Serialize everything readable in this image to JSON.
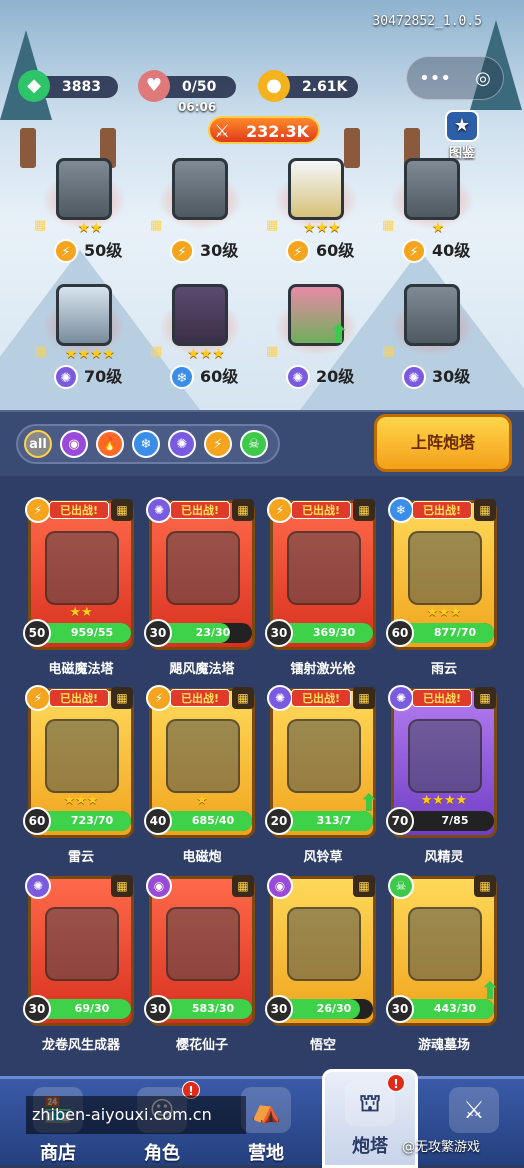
{
  "version": "30472852_1.0.5",
  "resources": {
    "gems": "3883",
    "stamina": "0/50",
    "stamina_timer": "06:06",
    "gold": "2.61K"
  },
  "combat_power": "232.3K",
  "codex_label": "图鉴",
  "capsule": {
    "more_icon": "•••",
    "close_icon": "◎"
  },
  "deployed": [
    {
      "level": "50级",
      "stars": "★★",
      "element": "lightning"
    },
    {
      "level": "30级",
      "stars": "",
      "element": "lightning"
    },
    {
      "level": "60级",
      "stars": "★★★",
      "element": "lightning"
    },
    {
      "level": "40级",
      "stars": "★",
      "element": "lightning"
    },
    {
      "level": "70级",
      "stars": "★★★★",
      "element": "wind"
    },
    {
      "level": "60级",
      "stars": "★★★",
      "element": "ice"
    },
    {
      "level": "20级",
      "stars": "",
      "element": "wind"
    },
    {
      "level": "30级",
      "stars": "",
      "element": "wind"
    }
  ],
  "filters": [
    "all",
    "arcane",
    "fire",
    "ice",
    "wind",
    "lightning",
    "poison"
  ],
  "deploy_button": "上阵炮塔",
  "deployed_tag": "已出战!",
  "cards": [
    {
      "name": "电磁魔法塔",
      "level": "50",
      "progress": "959/55",
      "stars": "★★",
      "style": "red",
      "element": "lightning",
      "deployed": true,
      "upgrade": false
    },
    {
      "name": "飓风魔法塔",
      "level": "30",
      "progress": "23/30",
      "stars": "",
      "style": "red",
      "element": "wind",
      "deployed": true,
      "upgrade": false
    },
    {
      "name": "镭射激光枪",
      "level": "30",
      "progress": "369/30",
      "stars": "",
      "style": "red",
      "element": "lightning",
      "deployed": true,
      "upgrade": false
    },
    {
      "name": "雨云",
      "level": "60",
      "progress": "877/70",
      "stars": "★★★",
      "style": "gold",
      "element": "ice",
      "deployed": true,
      "upgrade": false
    },
    {
      "name": "雷云",
      "level": "60",
      "progress": "723/70",
      "stars": "★★★",
      "style": "gold",
      "element": "lightning",
      "deployed": true,
      "upgrade": false
    },
    {
      "name": "电磁炮",
      "level": "40",
      "progress": "685/40",
      "stars": "★",
      "style": "gold",
      "element": "lightning",
      "deployed": true,
      "upgrade": false
    },
    {
      "name": "风铃草",
      "level": "20",
      "progress": "313/7",
      "stars": "",
      "style": "gold",
      "element": "wind",
      "deployed": true,
      "upgrade": true
    },
    {
      "name": "风精灵",
      "level": "70",
      "progress": "7/85",
      "stars": "★★★★",
      "style": "purple",
      "element": "wind",
      "deployed": true,
      "upgrade": false
    },
    {
      "name": "龙卷风生成器",
      "level": "30",
      "progress": "69/30",
      "stars": "",
      "style": "red",
      "element": "wind",
      "deployed": false,
      "upgrade": false
    },
    {
      "name": "樱花仙子",
      "level": "30",
      "progress": "583/30",
      "stars": "",
      "style": "red",
      "element": "arcane",
      "deployed": false,
      "upgrade": false
    },
    {
      "name": "悟空",
      "level": "30",
      "progress": "26/30",
      "stars": "",
      "style": "gold",
      "element": "arcane",
      "deployed": false,
      "upgrade": false
    },
    {
      "name": "游魂墓场",
      "level": "30",
      "progress": "443/30",
      "stars": "",
      "style": "gold",
      "element": "poison",
      "deployed": false,
      "upgrade": true
    }
  ],
  "nav": [
    {
      "label": "商店",
      "icon": "shop-icon",
      "badge": ""
    },
    {
      "label": "角色",
      "icon": "character-icon",
      "badge": "!"
    },
    {
      "label": "营地",
      "icon": "camp-icon",
      "badge": ""
    },
    {
      "label": "炮塔",
      "icon": "tower-icon",
      "badge": "!"
    },
    {
      "label": "",
      "icon": "sword-shield-icon",
      "badge": ""
    }
  ],
  "watermark": "zhiben-aiyouxi.com.cn",
  "watermark2": "@无攻繁游戏",
  "colors": {
    "lightning": "#f4a41d",
    "wind": "#7a5be0",
    "ice": "#3a8ee8",
    "fire": "#ff6a2a",
    "arcane": "#9a4ad8",
    "poison": "#3dc94a"
  }
}
